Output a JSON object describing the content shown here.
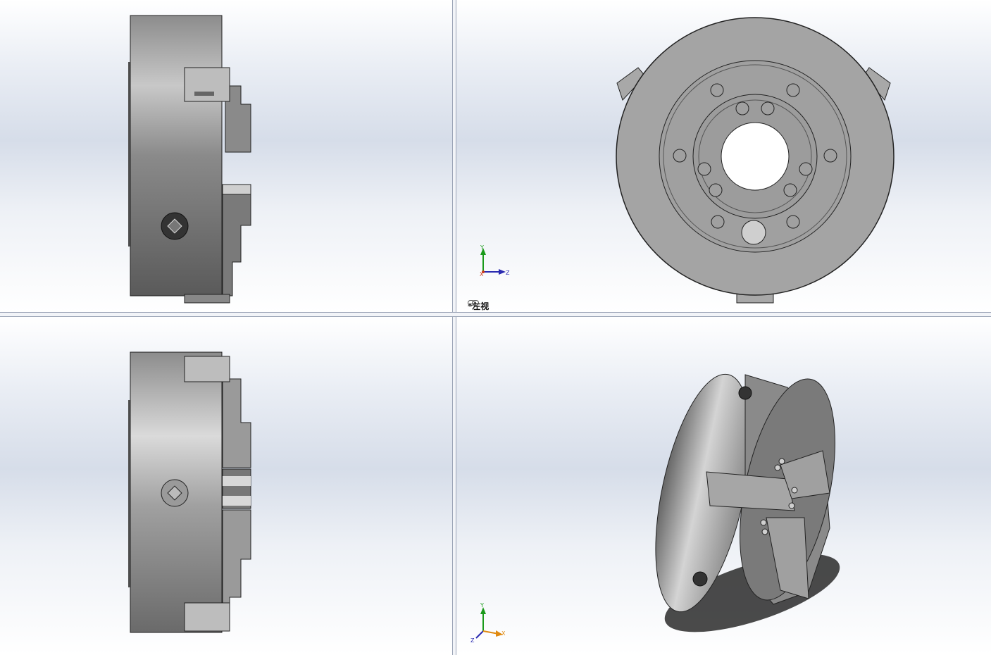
{
  "viewports": {
    "top_left": {
      "name": "front"
    },
    "top_right": {
      "name": "left",
      "view_label": "*左视",
      "label_icon": "link-chain-icon"
    },
    "bottom_left": {
      "name": "top"
    },
    "bottom_right": {
      "name": "isometric"
    }
  },
  "triad_left": {
    "y_label": "Y",
    "z_label": "Z",
    "x_label": "X"
  },
  "triad_iso": {
    "y_label": "Y",
    "z_label": "Z",
    "x_label": "X"
  },
  "colors": {
    "part_dark": "#5e5e5e",
    "part_mid": "#9a9a9a",
    "part_light": "#cfcfcf",
    "axis_y": "#1a9a1a",
    "axis_z": "#2a2ab0",
    "axis_x": "#cc3a1a",
    "axis_x_iso": "#e08a10"
  }
}
